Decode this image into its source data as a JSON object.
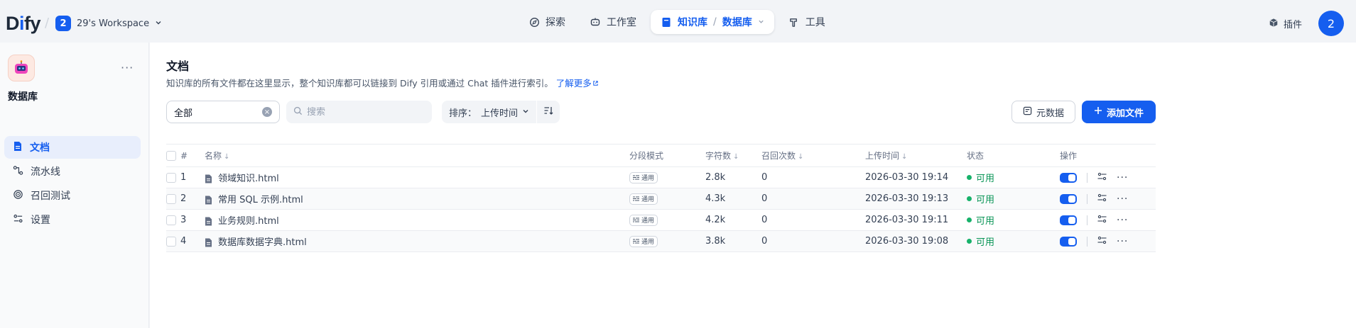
{
  "app": {
    "logo_prefix": "D",
    "logo_mid": "i",
    "logo_suffix": "fy",
    "workspace_badge": "2",
    "workspace_name": "29's Workspace"
  },
  "nav": {
    "explore": "探索",
    "studio": "工作室",
    "knowledge": "知识库",
    "knowledge_sub": "数据库",
    "tools": "工具"
  },
  "header_right": {
    "plugins": "插件",
    "avatar": "2"
  },
  "sidebar": {
    "kb_name": "数据库",
    "more": "···",
    "items": [
      {
        "label": "文档",
        "icon": "document-icon"
      },
      {
        "label": "流水线",
        "icon": "pipeline-icon"
      },
      {
        "label": "召回测试",
        "icon": "target-icon"
      },
      {
        "label": "设置",
        "icon": "settings-icon"
      }
    ]
  },
  "main": {
    "title": "文档",
    "subtitle": "知识库的所有文件都在这里显示，整个知识库都可以链接到 Dify 引用或通过 Chat 插件进行索引。",
    "learn_more": "了解更多",
    "filter_value": "全部",
    "search_placeholder": "搜索",
    "sort_prefix": "排序：",
    "sort_value": "上传时间",
    "meta_button": "元数据",
    "add_button": "添加文件"
  },
  "table": {
    "headers": {
      "index": "#",
      "name": "名称",
      "mode": "分段模式",
      "chars": "字符数",
      "hits": "召回次数",
      "uploaded": "上传时间",
      "status": "状态",
      "actions": "操作"
    },
    "rows": [
      {
        "index": "1",
        "name": "领域知识.html",
        "mode": "通用",
        "chars": "2.8k",
        "hits": "0",
        "uploaded": "2026-03-30 19:14",
        "status": "可用"
      },
      {
        "index": "2",
        "name": "常用 SQL 示例.html",
        "mode": "通用",
        "chars": "4.3k",
        "hits": "0",
        "uploaded": "2026-03-30 19:13",
        "status": "可用"
      },
      {
        "index": "3",
        "name": "业务规则.html",
        "mode": "通用",
        "chars": "4.2k",
        "hits": "0",
        "uploaded": "2026-03-30 19:11",
        "status": "可用"
      },
      {
        "index": "4",
        "name": "数据库数据字典.html",
        "mode": "通用",
        "chars": "3.8k",
        "hits": "0",
        "uploaded": "2026-03-30 19:08",
        "status": "可用"
      }
    ]
  },
  "colors": {
    "accent": "#155eef",
    "status_ok": "#17b26a"
  }
}
